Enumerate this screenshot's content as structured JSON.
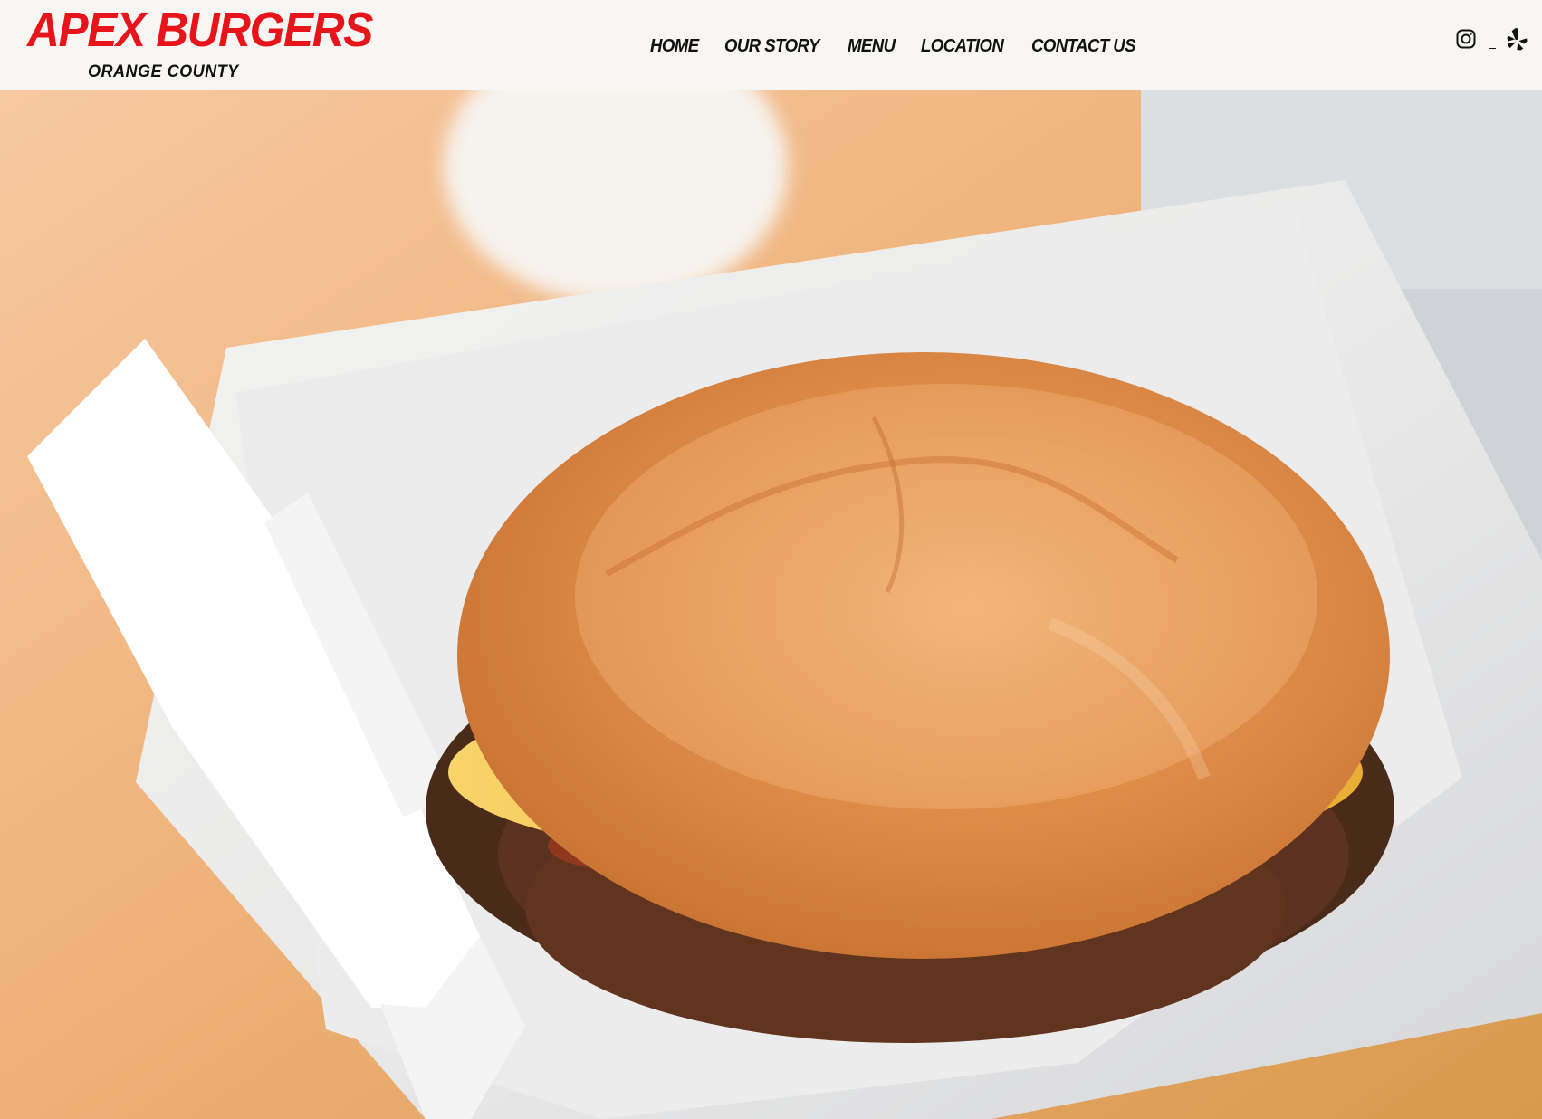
{
  "brand": {
    "name": "APEX BURGERS",
    "location": "ORANGE COUNTY",
    "color": "#e8141b"
  },
  "nav": {
    "items": [
      {
        "label": "HOME"
      },
      {
        "label": "OUR STORY"
      },
      {
        "label": "MENU"
      },
      {
        "label": "LOCATION"
      },
      {
        "label": "CONTACT US"
      }
    ]
  },
  "social": {
    "instagram_icon": "instagram-icon",
    "yelp_icon": "yelp-icon"
  },
  "hero": {
    "image": "cheeseburger-in-paper-box-photo"
  }
}
